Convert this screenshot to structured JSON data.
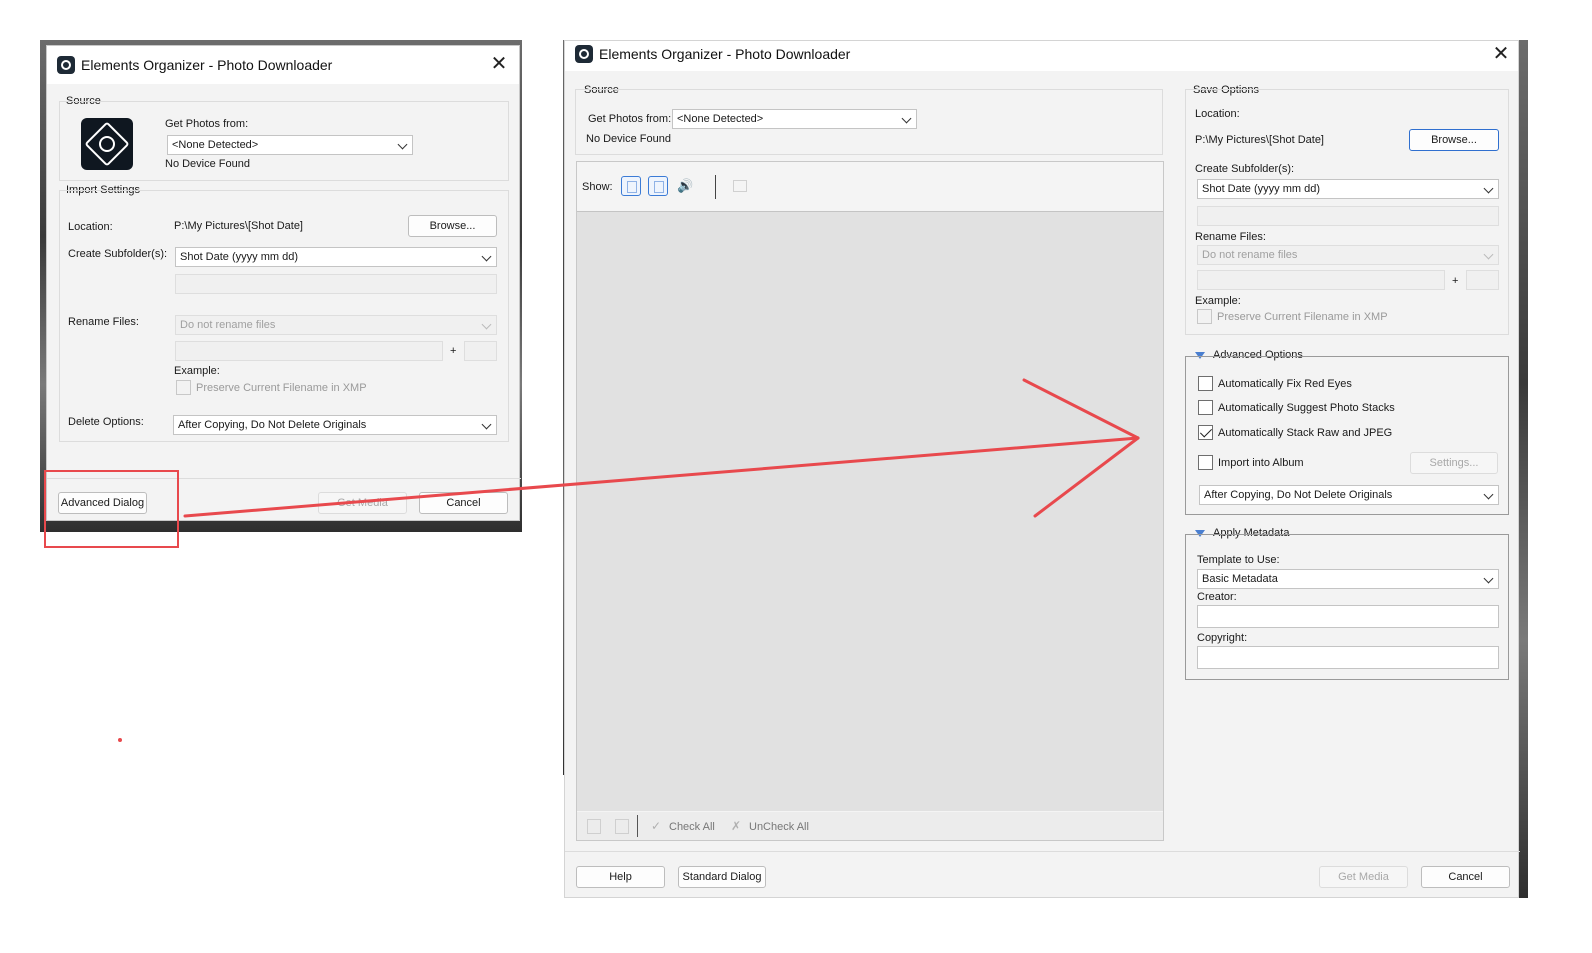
{
  "small_dialog": {
    "title": "Elements Organizer - Photo Downloader",
    "source_label": "Source",
    "get_photos_from_label": "Get Photos from:",
    "get_photos_from_value": "<None Detected>",
    "no_device": "No Device Found",
    "import_settings_label": "Import Settings",
    "location_label": "Location:",
    "location_value": "P:\\My Pictures\\[Shot Date]",
    "browse_label": "Browse...",
    "create_subfolder_label": "Create Subfolder(s):",
    "create_subfolder_value": "Shot Date (yyyy mm dd)",
    "rename_files_label": "Rename Files:",
    "rename_files_value": "Do not rename files",
    "plus": "+",
    "example_label": "Example:",
    "preserve_label": "Preserve Current Filename in XMP",
    "delete_options_label": "Delete Options:",
    "delete_options_value": "After Copying, Do Not Delete Originals",
    "advanced_dialog_label": "Advanced Dialog",
    "get_media_label": "Get Media",
    "cancel_label": "Cancel"
  },
  "large_dialog": {
    "title": "Elements Organizer - Photo Downloader",
    "source_label": "Source",
    "get_photos_from_label": "Get Photos from:",
    "get_photos_from_value": "<None Detected>",
    "no_device": "No Device Found",
    "show_label": "Show:",
    "check_all_label": "Check All",
    "uncheck_all_label": "UnCheck All",
    "save_options": {
      "header": "Save Options",
      "location_label": "Location:",
      "location_value": "P:\\My Pictures\\[Shot Date]",
      "browse_label": "Browse...",
      "create_subfolder_label": "Create Subfolder(s):",
      "create_subfolder_value": "Shot Date (yyyy mm dd)",
      "rename_files_label": "Rename Files:",
      "rename_files_value": "Do not rename files",
      "plus": "+",
      "example_label": "Example:",
      "preserve_label": "Preserve Current Filename in XMP"
    },
    "advanced_options": {
      "header": "Advanced Options",
      "fix_red_eyes_label": "Automatically Fix Red Eyes",
      "fix_red_eyes_checked": false,
      "suggest_stacks_label": "Automatically Suggest Photo Stacks",
      "suggest_stacks_checked": false,
      "stack_raw_jpeg_label": "Automatically Stack Raw and JPEG",
      "stack_raw_jpeg_checked": true,
      "import_album_label": "Import into Album",
      "import_album_checked": false,
      "settings_label": "Settings...",
      "delete_options_value": "After Copying, Do Not Delete Originals"
    },
    "apply_metadata": {
      "header": "Apply Metadata",
      "template_label": "Template to Use:",
      "template_value": "Basic Metadata",
      "creator_label": "Creator:",
      "creator_value": "",
      "copyright_label": "Copyright:",
      "copyright_value": ""
    },
    "help_label": "Help",
    "standard_dialog_label": "Standard Dialog",
    "get_media_label": "Get Media",
    "cancel_label": "Cancel"
  },
  "annotation": {
    "highlight_color": "#e8494d",
    "arrow_color": "#e8494d"
  }
}
